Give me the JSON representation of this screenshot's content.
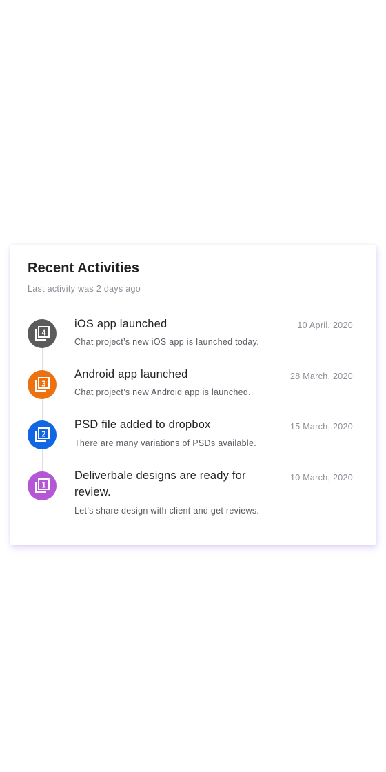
{
  "header": {
    "title": "Recent Activities",
    "subtitle": "Last activity was 2 days ago"
  },
  "activities": [
    {
      "title": "iOS app launched",
      "description": "Chat project’s new iOS app is launched today.",
      "date": "10 April, 2020",
      "icon": "filter-4-icon",
      "number": "4",
      "color": "#5b5b5b"
    },
    {
      "title": "Android app launched",
      "description": "Chat project’s new Android app is launched.",
      "date": "28 March, 2020",
      "icon": "filter-3-icon",
      "number": "3",
      "color": "#ee7110"
    },
    {
      "title": "PSD file added to dropbox",
      "description": "There are many variations of PSDs available.",
      "date": "15 March, 2020",
      "icon": "filter-2-icon",
      "number": "2",
      "color": "#1266e3"
    },
    {
      "title": "Deliverbale designs are ready for review.",
      "description": "Let’s share design with client and get reviews.",
      "date": "10 March, 2020",
      "icon": "filter-1-icon",
      "number": "1",
      "color": "#b456d6"
    }
  ]
}
